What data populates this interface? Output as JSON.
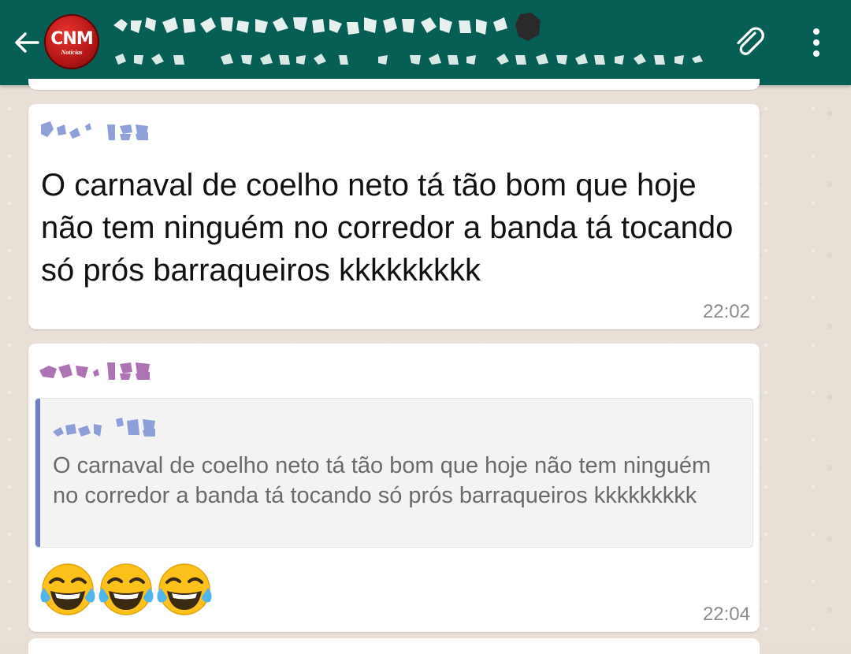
{
  "header": {
    "avatar_main": "CNM",
    "avatar_sub": "Notícias"
  },
  "messages": [
    {
      "text": "O carnaval de coelho neto tá tão bom que hoje não tem ninguém no corredor a banda tá tocando só prós barraqueiros kkkkkkkkk",
      "time": "22:02"
    },
    {
      "quote_text": "O carnaval de coelho neto tá tão bom que hoje não tem ninguém no corredor a banda tá tocando só prós barraqueiros kkkkkkkkk",
      "emojis": [
        "😂",
        "😂",
        "😂"
      ],
      "time": "22:04"
    }
  ],
  "colors": {
    "toolbar": "#075e54",
    "quote_bar": "#6f80c2",
    "sender_1": "#7a8fd0",
    "sender_2": "#a05aa6"
  },
  "icons": [
    "back-arrow-icon",
    "attach-icon",
    "more-vert-icon",
    "face-with-tears-of-joy-emoji"
  ]
}
